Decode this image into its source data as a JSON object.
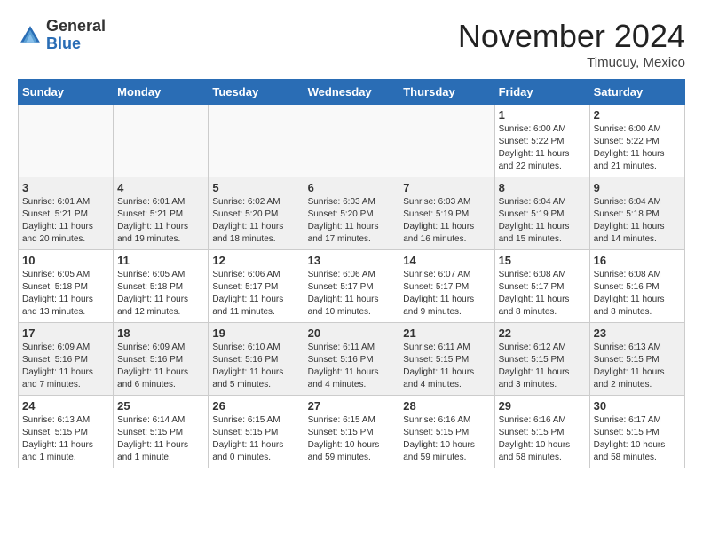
{
  "header": {
    "logo_line1": "General",
    "logo_line2": "Blue",
    "month": "November 2024",
    "location": "Timucuy, Mexico"
  },
  "weekdays": [
    "Sunday",
    "Monday",
    "Tuesday",
    "Wednesday",
    "Thursday",
    "Friday",
    "Saturday"
  ],
  "weeks": [
    [
      {
        "day": "",
        "info": ""
      },
      {
        "day": "",
        "info": ""
      },
      {
        "day": "",
        "info": ""
      },
      {
        "day": "",
        "info": ""
      },
      {
        "day": "",
        "info": ""
      },
      {
        "day": "1",
        "info": "Sunrise: 6:00 AM\nSunset: 5:22 PM\nDaylight: 11 hours\nand 22 minutes."
      },
      {
        "day": "2",
        "info": "Sunrise: 6:00 AM\nSunset: 5:22 PM\nDaylight: 11 hours\nand 21 minutes."
      }
    ],
    [
      {
        "day": "3",
        "info": "Sunrise: 6:01 AM\nSunset: 5:21 PM\nDaylight: 11 hours\nand 20 minutes."
      },
      {
        "day": "4",
        "info": "Sunrise: 6:01 AM\nSunset: 5:21 PM\nDaylight: 11 hours\nand 19 minutes."
      },
      {
        "day": "5",
        "info": "Sunrise: 6:02 AM\nSunset: 5:20 PM\nDaylight: 11 hours\nand 18 minutes."
      },
      {
        "day": "6",
        "info": "Sunrise: 6:03 AM\nSunset: 5:20 PM\nDaylight: 11 hours\nand 17 minutes."
      },
      {
        "day": "7",
        "info": "Sunrise: 6:03 AM\nSunset: 5:19 PM\nDaylight: 11 hours\nand 16 minutes."
      },
      {
        "day": "8",
        "info": "Sunrise: 6:04 AM\nSunset: 5:19 PM\nDaylight: 11 hours\nand 15 minutes."
      },
      {
        "day": "9",
        "info": "Sunrise: 6:04 AM\nSunset: 5:18 PM\nDaylight: 11 hours\nand 14 minutes."
      }
    ],
    [
      {
        "day": "10",
        "info": "Sunrise: 6:05 AM\nSunset: 5:18 PM\nDaylight: 11 hours\nand 13 minutes."
      },
      {
        "day": "11",
        "info": "Sunrise: 6:05 AM\nSunset: 5:18 PM\nDaylight: 11 hours\nand 12 minutes."
      },
      {
        "day": "12",
        "info": "Sunrise: 6:06 AM\nSunset: 5:17 PM\nDaylight: 11 hours\nand 11 minutes."
      },
      {
        "day": "13",
        "info": "Sunrise: 6:06 AM\nSunset: 5:17 PM\nDaylight: 11 hours\nand 10 minutes."
      },
      {
        "day": "14",
        "info": "Sunrise: 6:07 AM\nSunset: 5:17 PM\nDaylight: 11 hours\nand 9 minutes."
      },
      {
        "day": "15",
        "info": "Sunrise: 6:08 AM\nSunset: 5:17 PM\nDaylight: 11 hours\nand 8 minutes."
      },
      {
        "day": "16",
        "info": "Sunrise: 6:08 AM\nSunset: 5:16 PM\nDaylight: 11 hours\nand 8 minutes."
      }
    ],
    [
      {
        "day": "17",
        "info": "Sunrise: 6:09 AM\nSunset: 5:16 PM\nDaylight: 11 hours\nand 7 minutes."
      },
      {
        "day": "18",
        "info": "Sunrise: 6:09 AM\nSunset: 5:16 PM\nDaylight: 11 hours\nand 6 minutes."
      },
      {
        "day": "19",
        "info": "Sunrise: 6:10 AM\nSunset: 5:16 PM\nDaylight: 11 hours\nand 5 minutes."
      },
      {
        "day": "20",
        "info": "Sunrise: 6:11 AM\nSunset: 5:16 PM\nDaylight: 11 hours\nand 4 minutes."
      },
      {
        "day": "21",
        "info": "Sunrise: 6:11 AM\nSunset: 5:15 PM\nDaylight: 11 hours\nand 4 minutes."
      },
      {
        "day": "22",
        "info": "Sunrise: 6:12 AM\nSunset: 5:15 PM\nDaylight: 11 hours\nand 3 minutes."
      },
      {
        "day": "23",
        "info": "Sunrise: 6:13 AM\nSunset: 5:15 PM\nDaylight: 11 hours\nand 2 minutes."
      }
    ],
    [
      {
        "day": "24",
        "info": "Sunrise: 6:13 AM\nSunset: 5:15 PM\nDaylight: 11 hours\nand 1 minute."
      },
      {
        "day": "25",
        "info": "Sunrise: 6:14 AM\nSunset: 5:15 PM\nDaylight: 11 hours\nand 1 minute."
      },
      {
        "day": "26",
        "info": "Sunrise: 6:15 AM\nSunset: 5:15 PM\nDaylight: 11 hours\nand 0 minutes."
      },
      {
        "day": "27",
        "info": "Sunrise: 6:15 AM\nSunset: 5:15 PM\nDaylight: 10 hours\nand 59 minutes."
      },
      {
        "day": "28",
        "info": "Sunrise: 6:16 AM\nSunset: 5:15 PM\nDaylight: 10 hours\nand 59 minutes."
      },
      {
        "day": "29",
        "info": "Sunrise: 6:16 AM\nSunset: 5:15 PM\nDaylight: 10 hours\nand 58 minutes."
      },
      {
        "day": "30",
        "info": "Sunrise: 6:17 AM\nSunset: 5:15 PM\nDaylight: 10 hours\nand 58 minutes."
      }
    ]
  ]
}
